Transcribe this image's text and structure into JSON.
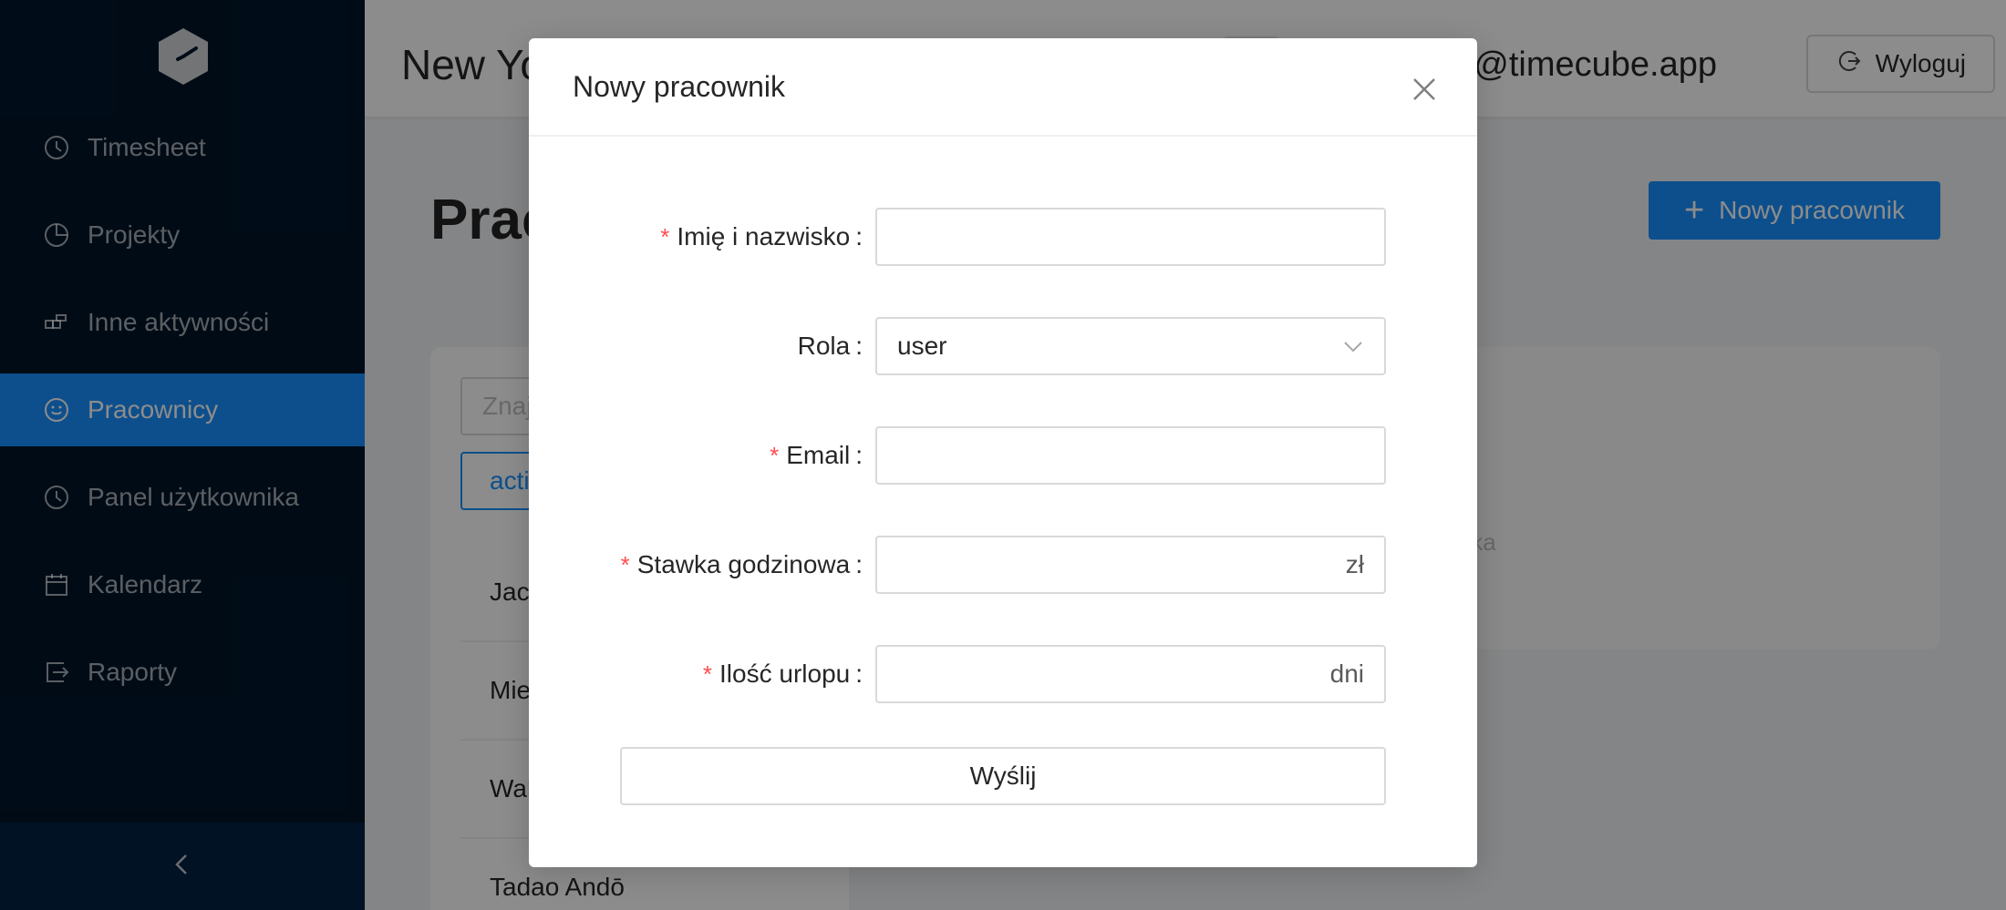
{
  "sidebar": {
    "logo_icon": "timecube-logo-icon",
    "items": [
      {
        "label": "Timesheet",
        "icon": "clock-icon"
      },
      {
        "label": "Projekty",
        "icon": "pie-chart-icon"
      },
      {
        "label": "Inne aktywności",
        "icon": "build-icon"
      },
      {
        "label": "Pracownicy",
        "icon": "smile-icon",
        "active": true
      },
      {
        "label": "Panel użytkownika",
        "icon": "clock-icon"
      },
      {
        "label": "Kalendarz",
        "icon": "calendar-icon"
      },
      {
        "label": "Raporty",
        "icon": "export-icon"
      }
    ],
    "collapse_icon": "chevron-left-icon"
  },
  "header": {
    "company": "New Yo",
    "user_email": "r@timecube.app",
    "logout_label": "Wyloguj"
  },
  "page": {
    "title": "Prac",
    "new_button_label": "Nowy pracownik",
    "search_placeholder": "Znaj",
    "filter_tag": "acti",
    "employees": [
      "Jac",
      "Mie",
      "Wal",
      "Tadao Andō"
    ],
    "empty_text": "ynika"
  },
  "modal": {
    "title": "Nowy pracownik",
    "fields": {
      "name": {
        "label": "Imię i nazwisko",
        "required": true,
        "value": ""
      },
      "role": {
        "label": "Rola",
        "required": false,
        "value": "user"
      },
      "email": {
        "label": "Email",
        "required": true,
        "value": ""
      },
      "rate": {
        "label": "Stawka godzinowa",
        "required": true,
        "value": "",
        "suffix": "zł"
      },
      "vacation": {
        "label": "Ilość urlopu",
        "required": true,
        "value": "",
        "suffix": "dni"
      }
    },
    "submit_label": "Wyślij"
  },
  "colors": {
    "sidebar_bg": "#001529",
    "primary": "#1890ff",
    "required_star": "#ff4d4f"
  }
}
